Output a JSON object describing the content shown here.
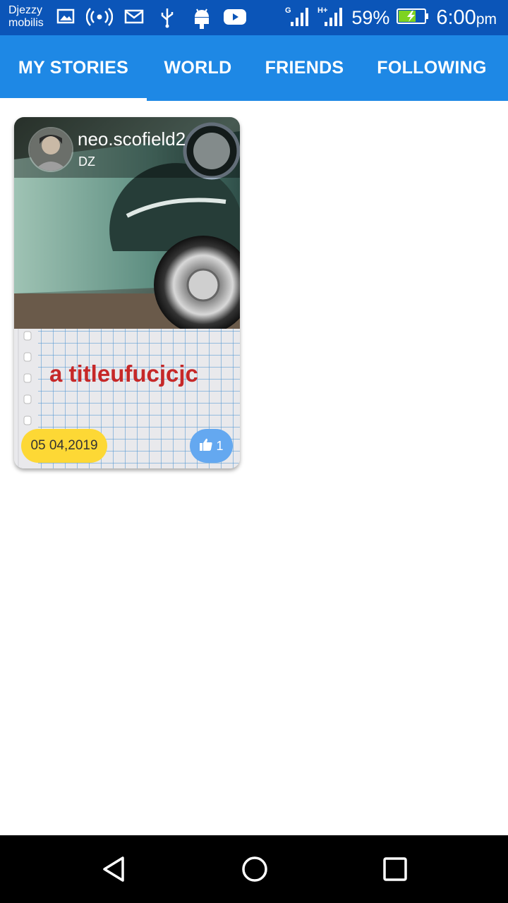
{
  "status_bar": {
    "carrier_line1": "Djezzy",
    "carrier_line2": "mobilis",
    "icons": [
      "image-icon",
      "hotspot-icon",
      "mail-icon",
      "usb-icon",
      "android-icon",
      "youtube-icon",
      "signal-g-icon",
      "signal-h-icon",
      "battery-charging-icon"
    ],
    "network1": "G",
    "network2": "H+",
    "battery": "59%",
    "time": "6:00",
    "ampm": "pm"
  },
  "tabs": [
    {
      "label": "MY STORIES",
      "active": true
    },
    {
      "label": "WORLD",
      "active": false
    },
    {
      "label": "FRIENDS",
      "active": false
    },
    {
      "label": "FOLLOWING",
      "active": false
    }
  ],
  "story": {
    "username": "neo.scofield2",
    "country": "DZ",
    "title": "a titleufucjcjc",
    "date": "05  04,2019",
    "likes": "1"
  },
  "nav": [
    "back-icon",
    "home-icon",
    "recents-icon"
  ],
  "colors": {
    "status_bar": "#0b55b8",
    "tab_bar": "#1e88e5",
    "title": "#c62828",
    "date_badge": "#fdd835",
    "like_badge": "#64a8f0"
  }
}
